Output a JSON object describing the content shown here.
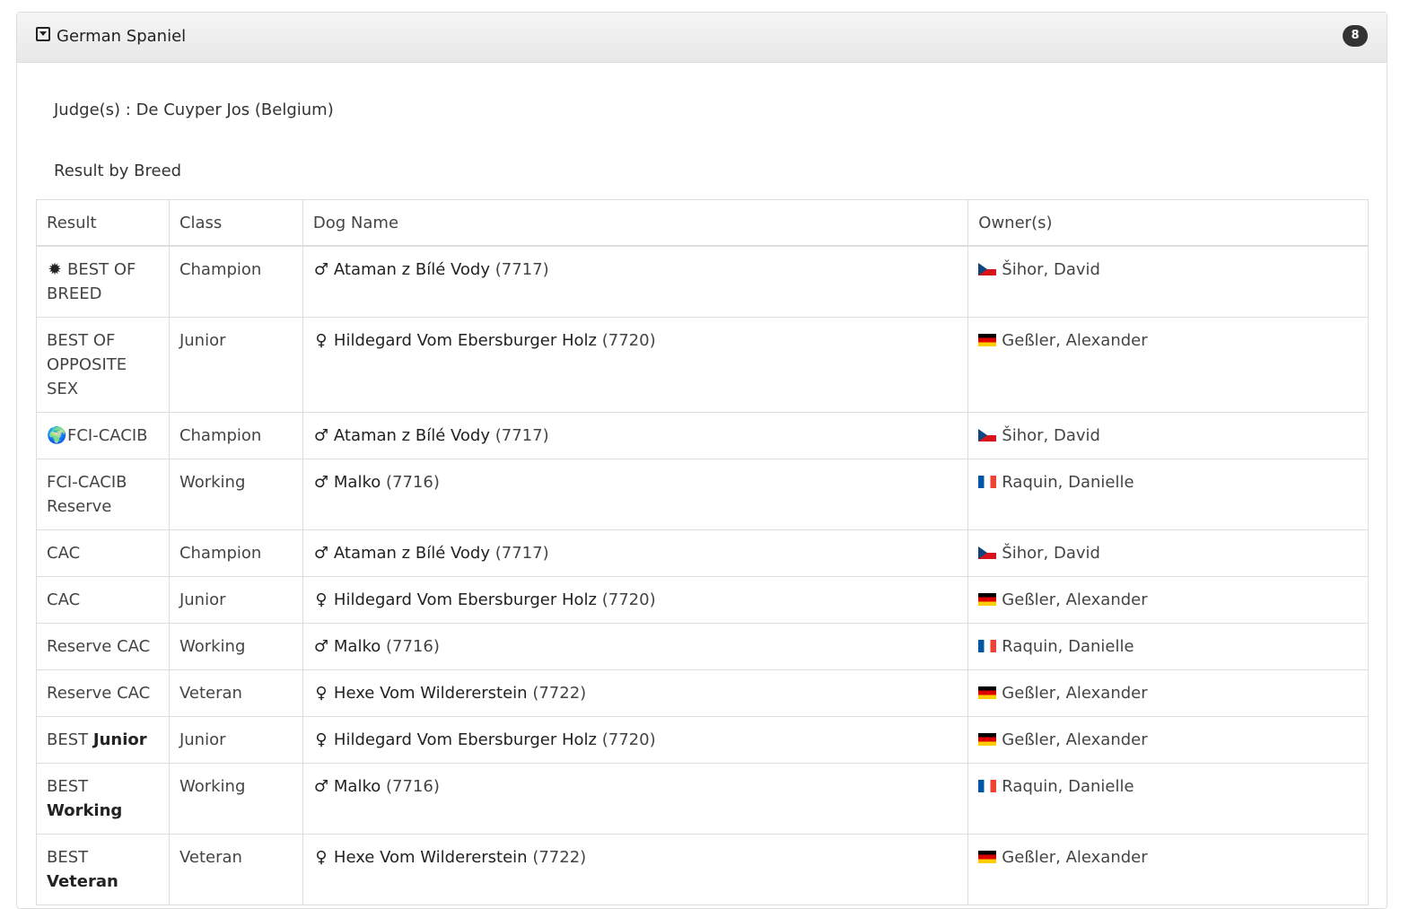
{
  "panel": {
    "title": "German Spaniel",
    "count": "8",
    "judges": "Judge(s) : De Cuyper Jos (Belgium)",
    "subtitle": "Result by Breed"
  },
  "table": {
    "headers": [
      "Result",
      "Class",
      "Dog Name",
      "Owner(s)"
    ],
    "rows": [
      {
        "icon": "award-star-icon",
        "result": "BEST OF BREED",
        "result_bold": "",
        "class": "Champion",
        "sex": "male-icon",
        "dog": "Ataman z Bílé Vody",
        "dog_id": "(7717)",
        "flag": "cz",
        "owner": "Šihor, David"
      },
      {
        "icon": "",
        "result": "BEST OF OPPOSITE SEX",
        "result_bold": "",
        "class": "Junior",
        "sex": "female-icon",
        "dog": "Hildegard Vom Ebersburger Holz",
        "dog_id": "(7720)",
        "flag": "de",
        "owner": "Geßler, Alexander"
      },
      {
        "icon": "globe-icon",
        "result": "FCI-CACIB",
        "result_bold": "",
        "class": "Champion",
        "sex": "male-icon",
        "dog": "Ataman z Bílé Vody",
        "dog_id": "(7717)",
        "flag": "cz",
        "owner": "Šihor, David"
      },
      {
        "icon": "",
        "result": "FCI-CACIB Reserve",
        "result_bold": "",
        "class": "Working",
        "sex": "male-icon",
        "dog": "Malko",
        "dog_id": "(7716)",
        "flag": "fr",
        "owner": "Raquin, Danielle"
      },
      {
        "icon": "",
        "result": "CAC",
        "result_bold": "",
        "class": "Champion",
        "sex": "male-icon",
        "dog": "Ataman z Bílé Vody",
        "dog_id": "(7717)",
        "flag": "cz",
        "owner": "Šihor, David"
      },
      {
        "icon": "",
        "result": "CAC",
        "result_bold": "",
        "class": "Junior",
        "sex": "female-icon",
        "dog": "Hildegard Vom Ebersburger Holz",
        "dog_id": "(7720)",
        "flag": "de",
        "owner": "Geßler, Alexander"
      },
      {
        "icon": "",
        "result": "Reserve CAC",
        "result_bold": "",
        "class": "Working",
        "sex": "male-icon",
        "dog": "Malko",
        "dog_id": "(7716)",
        "flag": "fr",
        "owner": "Raquin, Danielle"
      },
      {
        "icon": "",
        "result": "Reserve CAC",
        "result_bold": "",
        "class": "Veteran",
        "sex": "female-icon",
        "dog": "Hexe Vom Wildererstein",
        "dog_id": "(7722)",
        "flag": "de",
        "owner": "Geßler, Alexander"
      },
      {
        "icon": "",
        "result": "BEST",
        "result_bold": "Junior",
        "class": "Junior",
        "sex": "female-icon",
        "dog": "Hildegard Vom Ebersburger Holz",
        "dog_id": "(7720)",
        "flag": "de",
        "owner": "Geßler, Alexander"
      },
      {
        "icon": "",
        "result": "BEST",
        "result_bold": "Working",
        "class": "Working",
        "sex": "male-icon",
        "dog": "Malko",
        "dog_id": "(7716)",
        "flag": "fr",
        "owner": "Raquin, Danielle"
      },
      {
        "icon": "",
        "result": "BEST",
        "result_bold": "Veteran",
        "class": "Veteran",
        "sex": "female-icon",
        "dog": "Hexe Vom Wildererstein",
        "dog_id": "(7722)",
        "flag": "de",
        "owner": "Geßler, Alexander"
      }
    ]
  }
}
